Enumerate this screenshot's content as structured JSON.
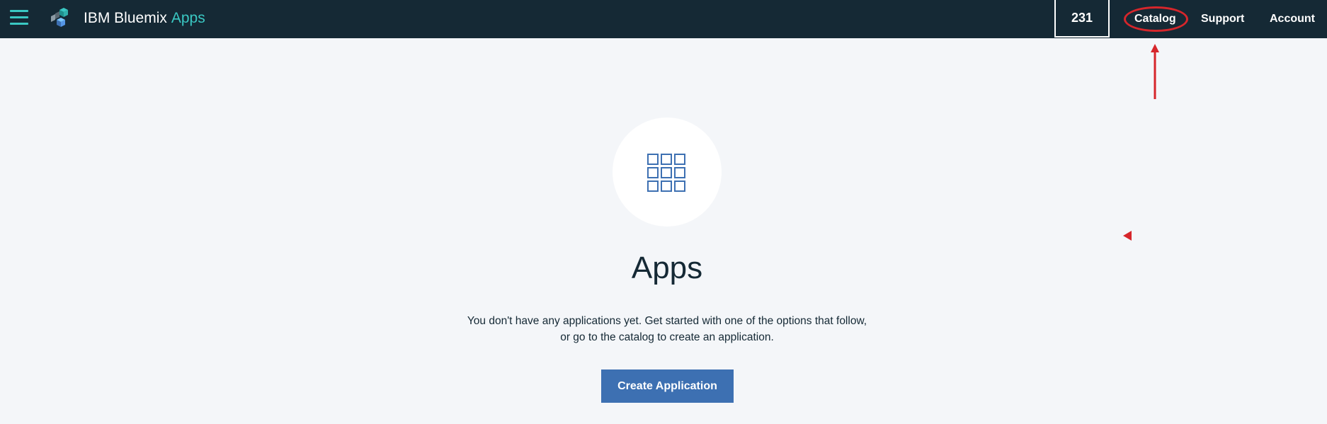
{
  "header": {
    "brand_name": "IBM Bluemix",
    "section_name": "Apps",
    "counter_value": "231",
    "nav": {
      "catalog": "Catalog",
      "support": "Support",
      "account": "Account"
    }
  },
  "main": {
    "icon": "grid-icon",
    "title": "Apps",
    "description_line1": "You don't have any applications yet. Get started with one of the options that follow,",
    "description_line2": "or go to the catalog to create an application.",
    "create_button_label": "Create Application"
  },
  "colors": {
    "header_bg": "#152935",
    "accent": "#3ac8c3",
    "primary_button": "#3d70b2",
    "page_bg": "#f4f6f9",
    "annotation": "#d6262b"
  }
}
